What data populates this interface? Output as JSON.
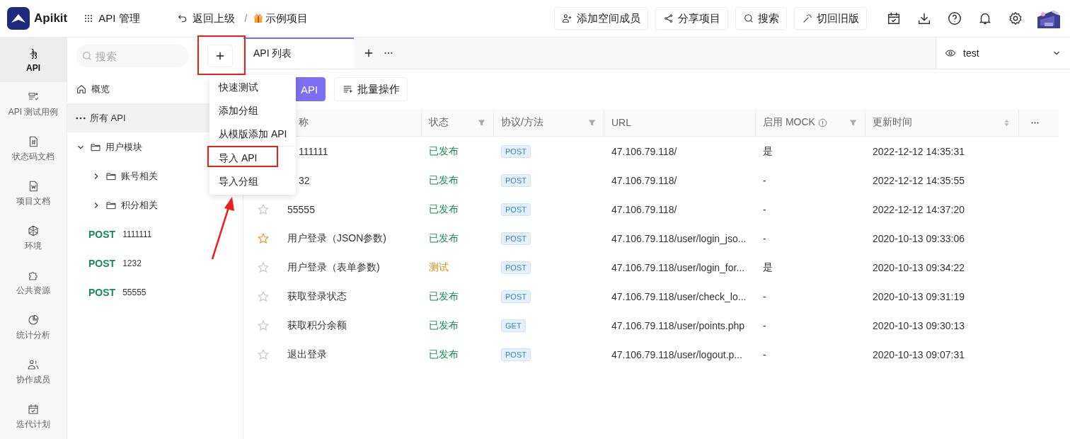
{
  "header": {
    "logo": "Apikit",
    "nav": "API 管理",
    "back": "返回上级",
    "separator": "/",
    "project": "示例项目",
    "buttons": [
      {
        "label": "添加空间成员",
        "kind": "member"
      },
      {
        "label": "分享项目",
        "kind": "share"
      },
      {
        "label": "搜索",
        "kind": "search"
      },
      {
        "label": "切回旧版",
        "kind": "magic"
      }
    ]
  },
  "rail": [
    {
      "label": "API",
      "kind": "api",
      "selected": true
    },
    {
      "label": "API 测试用例",
      "kind": "cases",
      "selected": false
    },
    {
      "label": "状态码文档",
      "kind": "code",
      "selected": false
    },
    {
      "label": "项目文档",
      "kind": "doc",
      "selected": false
    },
    {
      "label": "环境",
      "kind": "env",
      "selected": false
    },
    {
      "label": "公共资源",
      "kind": "puzzle",
      "selected": false
    },
    {
      "label": "统计分析",
      "kind": "chart",
      "selected": false
    },
    {
      "label": "协作成员",
      "kind": "users",
      "selected": false
    },
    {
      "label": "迭代计划",
      "kind": "plan",
      "selected": false
    }
  ],
  "sidebar": {
    "search": {
      "placeholder": "搜索"
    },
    "add_marked": true,
    "overview": "概览",
    "tree": [
      {
        "kind": "all",
        "label": "所有 API",
        "selected": true
      },
      {
        "kind": "folder",
        "label": "用户模块",
        "expanded": true,
        "selected": false,
        "children": [
          {
            "kind": "folder",
            "label": "账号相关",
            "expanded": false,
            "selected": false
          },
          {
            "kind": "folder",
            "label": "积分相关",
            "expanded": false,
            "selected": false
          }
        ]
      },
      {
        "kind": "api",
        "method": "POST",
        "label": "1111111",
        "selected": false
      },
      {
        "kind": "api",
        "method": "POST",
        "label": "1232",
        "selected": false
      },
      {
        "kind": "api",
        "method": "POST",
        "label": "55555",
        "selected": false
      }
    ]
  },
  "tabs": [
    {
      "label": "API 列表",
      "selected": true
    }
  ],
  "env": {
    "label": "test"
  },
  "menu": [
    {
      "label": "快速测试",
      "marked": false
    },
    {
      "label": "添加分组",
      "marked": false
    },
    {
      "label": "从模版添加 API",
      "marked": false
    },
    {
      "label": "导入 API",
      "marked": true
    },
    {
      "label": "导入分组",
      "marked": false
    }
  ],
  "toolbar": [
    {
      "label": "API",
      "kind": "primary"
    },
    {
      "label": "批量操作",
      "kind": "batch"
    }
  ],
  "table": {
    "columns": [
      {
        "label": "称",
        "kind": "plain"
      },
      {
        "label": "状态",
        "kind": "filter"
      },
      {
        "label": "协议/方法",
        "kind": "filter"
      },
      {
        "label": "URL",
        "kind": "plain"
      },
      {
        "label": "启用 MOCK",
        "kind": "info-filter"
      },
      {
        "label": "更新时间",
        "kind": "sort"
      }
    ],
    "rows": [
      {
        "name": "111111",
        "status": "已发布",
        "color": "#178a53",
        "method": "POST",
        "url": "47.106.79.118/",
        "mock": "是",
        "updated": "2022-12-12 14:35:31"
      },
      {
        "name": "32",
        "status": "已发布",
        "color": "#178a53",
        "method": "POST",
        "url": "47.106.79.118/",
        "mock": "-",
        "updated": "2022-12-12 14:35:55"
      },
      {
        "starred": false,
        "name": "55555",
        "status": "已发布",
        "color": "#178a53",
        "method": "POST",
        "url": "47.106.79.118/",
        "mock": "-",
        "updated": "2022-12-12 14:37:20"
      },
      {
        "starred": true,
        "name": "用户登录（JSON参数)",
        "status": "已发布",
        "color": "#178a53",
        "method": "POST",
        "url": "47.106.79.118/user/login_jso...",
        "mock": "-",
        "updated": "2020-10-13 09:33:06"
      },
      {
        "starred": false,
        "name": "用户登录（表单参数)",
        "status": "测试",
        "color": "#e0890b",
        "method": "POST",
        "url": "47.106.79.118/user/login_for...",
        "mock": "是",
        "updated": "2020-10-13 09:34:22"
      },
      {
        "starred": false,
        "name": "获取登录状态",
        "status": "已发布",
        "color": "#178a53",
        "method": "POST",
        "url": "47.106.79.118/user/check_lo...",
        "mock": "-",
        "updated": "2020-10-13 09:31:19"
      },
      {
        "starred": false,
        "name": "获取积分余额",
        "status": "已发布",
        "color": "#178a53",
        "method": "GET",
        "url": "47.106.79.118/user/points.php",
        "mock": "-",
        "updated": "2020-10-13 09:30:13"
      },
      {
        "starred": false,
        "name": "退出登录",
        "status": "已发布",
        "color": "#178a53",
        "method": "POST",
        "url": "47.106.79.118/user/logout.p...",
        "mock": "-",
        "updated": "2020-10-13 09:07:31"
      }
    ]
  }
}
